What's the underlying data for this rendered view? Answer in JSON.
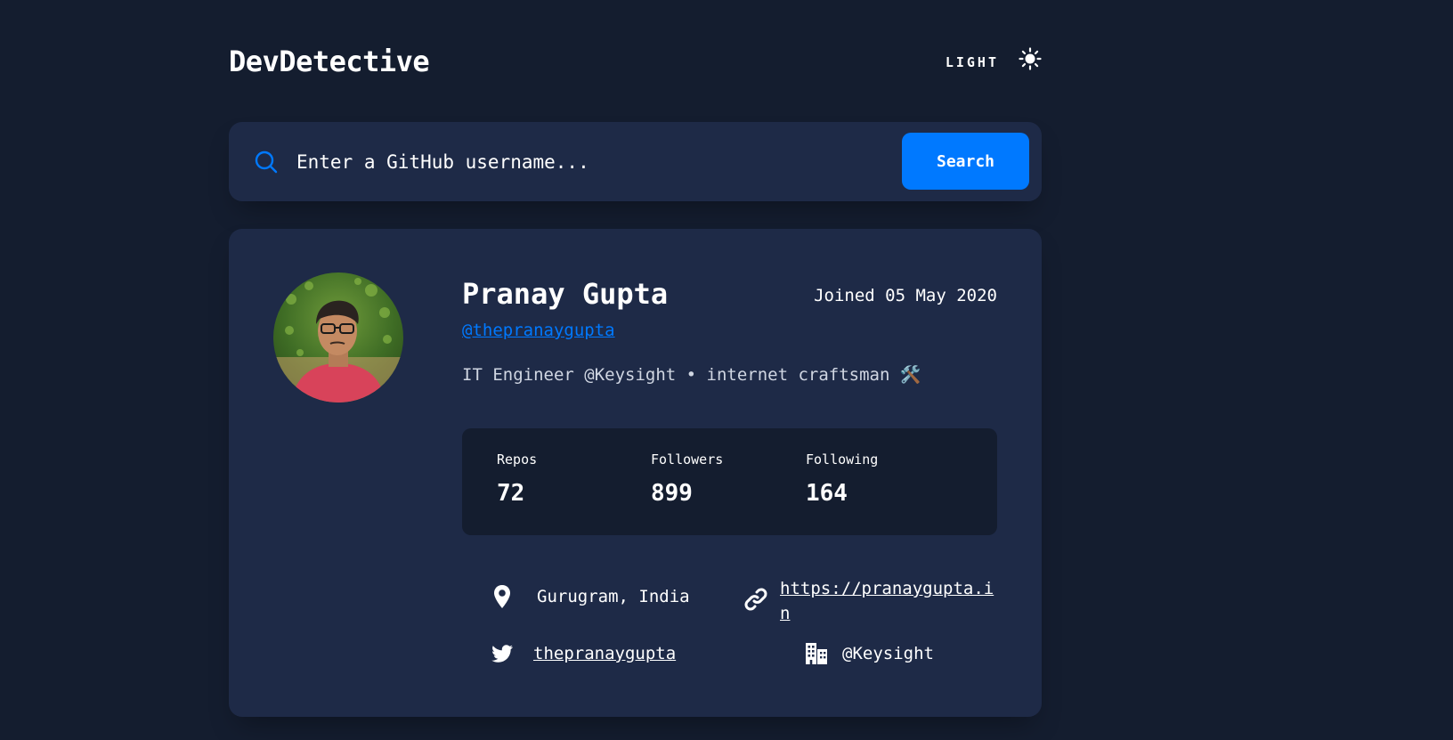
{
  "app": {
    "title": "DevDetective",
    "theme_label": "LIGHT",
    "theme_icon": "sun-icon"
  },
  "search": {
    "placeholder": "Enter a GitHub username...",
    "value": "",
    "button_label": "Search",
    "icon": "search-icon"
  },
  "profile": {
    "avatar_icon": "avatar-photo",
    "name": "Pranay Gupta",
    "joined": "Joined 05 May 2020",
    "login": "@thepranaygupta",
    "bio": "IT Engineer @Keysight • internet craftsman 🛠️",
    "stats": [
      {
        "label": "Repos",
        "value": "72"
      },
      {
        "label": "Followers",
        "value": "899"
      },
      {
        "label": "Following",
        "value": "164"
      }
    ],
    "links": {
      "location": {
        "icon": "location-pin-icon",
        "text": "Gurugram, India"
      },
      "blog": {
        "icon": "link-icon",
        "text": "https://pranaygupta.in"
      },
      "twitter": {
        "icon": "twitter-icon",
        "text": "thepranaygupta"
      },
      "company": {
        "icon": "building-icon",
        "text": "@Keysight"
      }
    }
  },
  "colors": {
    "background": "#141d2f",
    "card": "#1e2a47",
    "accent": "#0079ff",
    "text": "#ffffff"
  }
}
